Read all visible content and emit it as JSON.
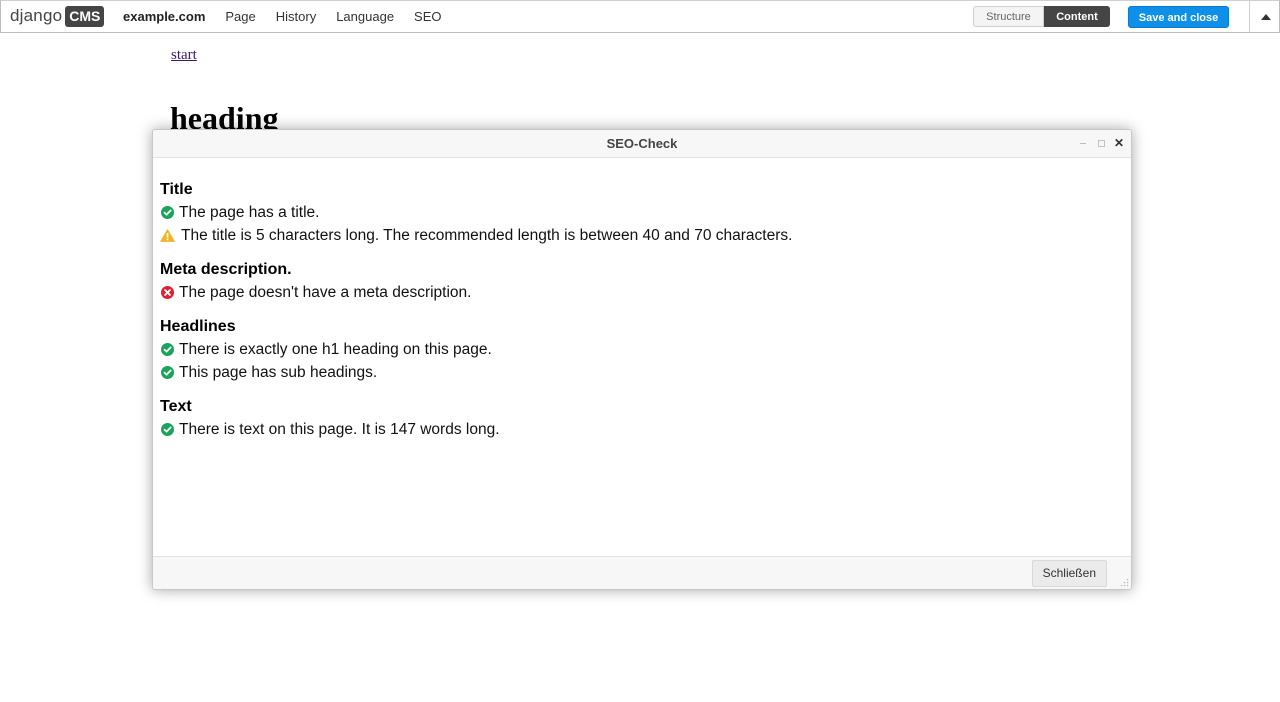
{
  "toolbar": {
    "logo_text": "django",
    "logo_badge": "CMS",
    "site_name": "example.com",
    "menu": [
      "Page",
      "History",
      "Language",
      "SEO"
    ],
    "structure_label": "Structure",
    "content_label": "Content",
    "save_label": "Save and close",
    "toggle_icon": "triangle-up-icon"
  },
  "page": {
    "link_text": "start",
    "heading": "heading"
  },
  "modal": {
    "title": "SEO-Check",
    "close_button_label": "Schließen",
    "sections": [
      {
        "title": "Title",
        "checks": [
          {
            "status": "ok",
            "text": "The page has a title."
          },
          {
            "status": "warning",
            "text": "The title is 5 characters long. The recommended length is between 40 and 70 characters."
          }
        ]
      },
      {
        "title": "Meta description.",
        "checks": [
          {
            "status": "error",
            "text": "The page doesn't have a meta description."
          }
        ]
      },
      {
        "title": "Headlines",
        "checks": [
          {
            "status": "ok",
            "text": "There is exactly one h1 heading on this page."
          },
          {
            "status": "ok",
            "text": "This page has sub headings."
          }
        ]
      },
      {
        "title": "Text",
        "checks": [
          {
            "status": "ok",
            "text": "There is text on this page. It is 147 words long."
          }
        ]
      }
    ]
  },
  "colors": {
    "ok": "#1aa35a",
    "warning": "#f0b429",
    "error": "#e0202e",
    "save_button": "#0e8fe8",
    "link": "#3a1a6b"
  }
}
